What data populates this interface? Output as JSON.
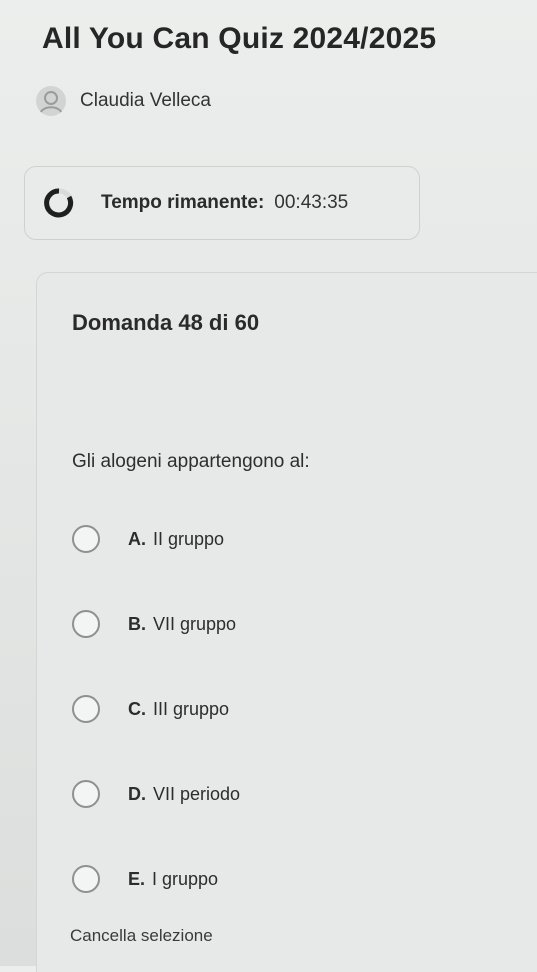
{
  "header": {
    "title": "All You Can Quiz 2024/2025",
    "user_name": "Claudia Velleca"
  },
  "timer": {
    "label": "Tempo rimanente:",
    "value": "00:43:35"
  },
  "question": {
    "number_text": "Domanda 48 di 60",
    "text": "Gli alogeni appartengono al:",
    "options": [
      {
        "letter": "A.",
        "text": "II gruppo"
      },
      {
        "letter": "B.",
        "text": "VII gruppo"
      },
      {
        "letter": "C.",
        "text": "III gruppo"
      },
      {
        "letter": "D.",
        "text": "VII periodo"
      },
      {
        "letter": "E.",
        "text": "I gruppo"
      }
    ]
  },
  "actions": {
    "clear_label": "Cancella selezione"
  },
  "icons": {
    "avatar": "user-avatar-icon",
    "timer": "timer-progress-icon"
  },
  "colors": {
    "background": "#e6e8e7",
    "text": "#2a2a2a",
    "radio_border": "#8e9190",
    "timer_ring": "#1f1f1f"
  }
}
